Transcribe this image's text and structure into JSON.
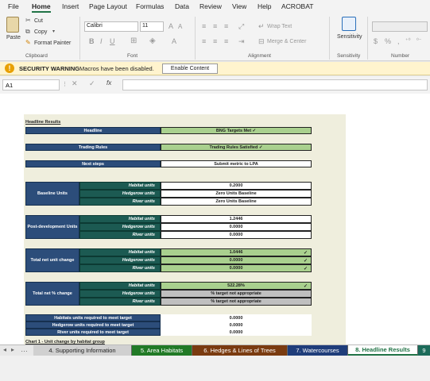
{
  "menu": [
    "File",
    "Home",
    "Insert",
    "Page Layout",
    "Formulas",
    "Data",
    "Review",
    "View",
    "Help",
    "ACROBAT"
  ],
  "ribbon": {
    "paste": "Paste",
    "cut": "Cut",
    "copy": "Copy",
    "format_painter": "Format Painter",
    "font_name": "Calibri",
    "font_size": "11",
    "wrap_text": "Wrap Text",
    "merge_center": "Merge & Center",
    "sensitivity": "Sensitivity",
    "groups": {
      "clipboard": "Clipboard",
      "font": "Font",
      "alignment": "Alignment",
      "sensitivity": "Sensitivity",
      "number": "Number"
    }
  },
  "warning": {
    "title": "SECURITY WARNING",
    "message": "Macros have been disabled.",
    "button": "Enable Content"
  },
  "formula_bar": {
    "name_box": "A1",
    "fx": "fx",
    "value": ""
  },
  "sheet": {
    "heading": "Headline Results",
    "headline_label": "Headline",
    "headline_value": "BNG Targets Met ✓",
    "trading_label": "Trading Rules",
    "trading_value": "Trading Rules Satisfied ✓",
    "next_label": "Next steps",
    "next_value": "Submit metric to LPA",
    "baseline": {
      "label": "Baseline Units",
      "rows": [
        {
          "type": "Habitat units",
          "value": "0.2000"
        },
        {
          "type": "Hedgerow units",
          "value": "Zero Units Baseline"
        },
        {
          "type": "River units",
          "value": "Zero Units Baseline"
        }
      ]
    },
    "postdev": {
      "label": "Post-development Units",
      "rows": [
        {
          "type": "Habitat units",
          "value": "1.2446"
        },
        {
          "type": "Hedgerow units",
          "value": "0.0000"
        },
        {
          "type": "River units",
          "value": "0.0000"
        }
      ]
    },
    "netunit": {
      "label": "Total net unit change",
      "rows": [
        {
          "type": "Habitat units",
          "value": "1.0446",
          "check": "✓"
        },
        {
          "type": "Hedgerow units",
          "value": "0.0000",
          "check": "✓"
        },
        {
          "type": "River units",
          "value": "0.0000",
          "check": "✓"
        }
      ]
    },
    "netpct": {
      "label": "Total net % change",
      "rows": [
        {
          "type": "Habitat units",
          "value": "522.28%",
          "check": "✓"
        },
        {
          "type": "Hedgerow units",
          "value": "% target not appropriate",
          "check": ""
        },
        {
          "type": "River units",
          "value": "% target not appropriate",
          "check": ""
        }
      ]
    },
    "required": [
      {
        "label": "Habitats units required to meet target",
        "value": "0.0000"
      },
      {
        "label": "Hedgerow units required to meet target",
        "value": "0.0000"
      },
      {
        "label": "River units required to meet target",
        "value": "0.0000"
      }
    ],
    "chart_caption": "Chart 1 - Unit change by habitat group"
  },
  "tabs": [
    {
      "label": "4. Supporting Information",
      "color": "#d0d0d0",
      "text": "#222"
    },
    {
      "label": "5. Area Habitats",
      "color": "#217a26",
      "text": "#ffffff"
    },
    {
      "label": "6. Hedges & Lines of Trees",
      "color": "#7a3b10",
      "text": "#ffffff"
    },
    {
      "label": "7. Watercourses",
      "color": "#1f3d7a",
      "text": "#ffffff"
    },
    {
      "label": "8. Headline Results",
      "color": "#ffffff",
      "text": "#217346"
    },
    {
      "label": "9",
      "color": "#1c6b5a",
      "text": "#ffffff"
    }
  ],
  "colors": {
    "excel_green": "#217346",
    "header_blue": "#2c4d7a",
    "teal": "#1c5a52",
    "light_green": "#a9d08e"
  }
}
